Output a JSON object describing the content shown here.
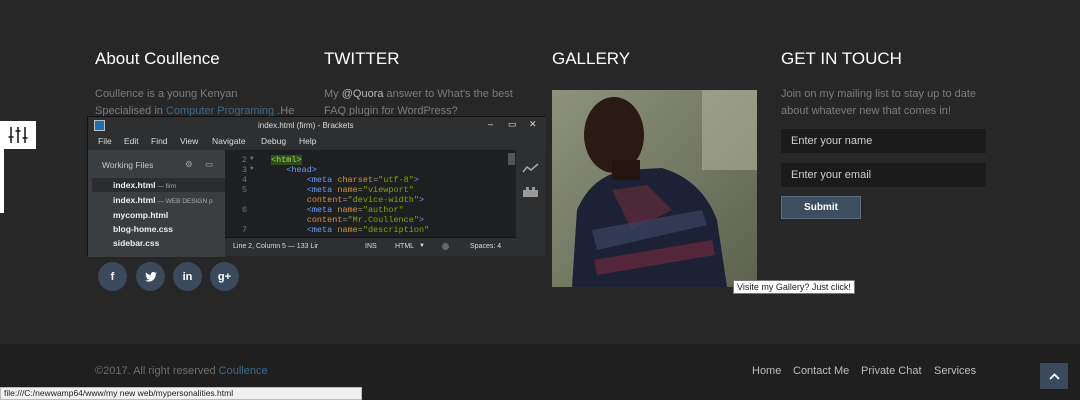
{
  "about": {
    "title": "About Coullence",
    "line1": "Coullence is a young Kenyan",
    "line2_a": "Specialised in ",
    "line2_link": "Computer Programing",
    "line2_b": " .He"
  },
  "twitter": {
    "title": "TWITTER",
    "line1_a": "My ",
    "line1_mention": "@Quora",
    "line1_b": " answer to What's the best",
    "line2": "FAQ plugin for WordPress?"
  },
  "gallery": {
    "title": "GALLERY",
    "tooltip": "Visite my Gallery? Just click!"
  },
  "contact": {
    "title": "GET IN TOUCH",
    "line1": "Join on my mailing list to stay up to date",
    "line2": "about whatever new that comes in!",
    "name_placeholder": "Enter your name",
    "email_placeholder": "Enter your email",
    "submit_label": "Submit"
  },
  "brackets": {
    "title": "index.html (firm) - Brackets",
    "menu": [
      "File",
      "Edit",
      "Find",
      "View",
      "Navigate",
      "Debug",
      "Help"
    ],
    "working_files_label": "Working Files",
    "files": [
      {
        "name": "index.html",
        "note": " — firm"
      },
      {
        "name": "index.html",
        "note": " — WEB DESIGN p"
      },
      {
        "name": "mycomp.html",
        "note": ""
      },
      {
        "name": "blog-home.css",
        "note": ""
      },
      {
        "name": "sidebar.css",
        "note": ""
      }
    ],
    "line_numbers": [
      "2",
      "3",
      "4",
      "5",
      "",
      "6",
      "",
      "7"
    ],
    "status": {
      "position": "Line 2, Column 5 — 133 Lir",
      "mode": "INS",
      "lang": "HTML",
      "spaces": "Spaces:  4"
    }
  },
  "social": [
    {
      "icon": "facebook-icon",
      "glyph": "f"
    },
    {
      "icon": "twitter-icon",
      "glyph": "t"
    },
    {
      "icon": "linkedin-icon",
      "glyph": "in"
    },
    {
      "icon": "googleplus-icon",
      "glyph": "g+"
    }
  ],
  "footer": {
    "copyright_a": "©2017. All right reserved ",
    "copyright_link": "Coullence",
    "nav": [
      "Home",
      "Contact Me",
      "Private Chat",
      "Services"
    ]
  },
  "browser_status_url": "file:///C:/newwamp64/www/my new web/mypersonalities.html",
  "colors": {
    "background": "#272727",
    "footer": "#1f1f1f",
    "accent": "#3b4a5a",
    "link": "#3c6a8a"
  }
}
